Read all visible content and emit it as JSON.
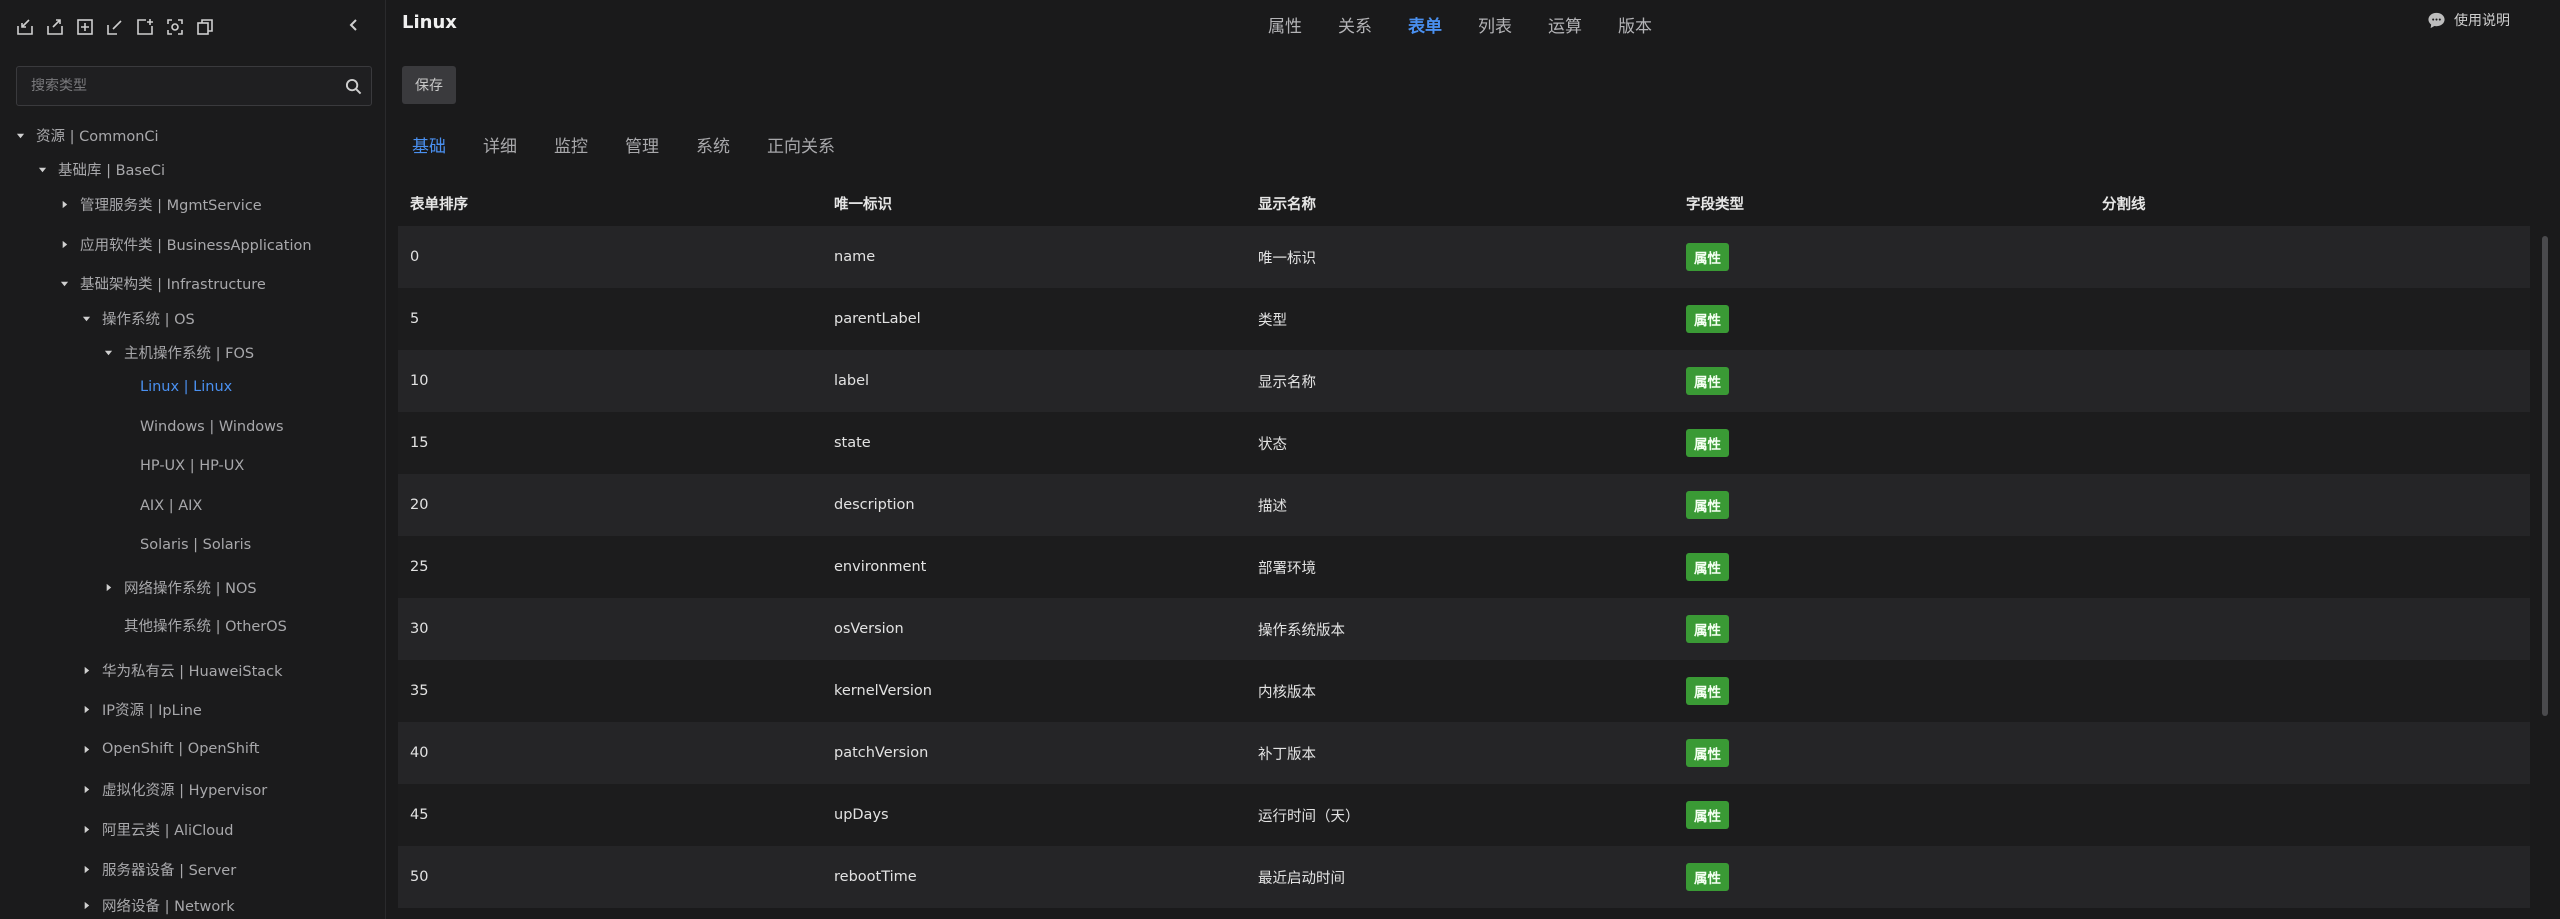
{
  "sidebar": {
    "search_placeholder": "搜索类型",
    "tree": [
      {
        "label": "资源 | CommonCi",
        "level": 0,
        "arrow": "down"
      },
      {
        "label": "基础库 | BaseCi",
        "level": 1,
        "arrow": "down"
      },
      {
        "label": "管理服务类 | MgmtService",
        "level": 2,
        "arrow": "right"
      },
      {
        "label": "应用软件类 | BusinessApplication",
        "level": 2,
        "arrow": "right"
      },
      {
        "label": "基础架构类 | Infrastructure",
        "level": 2,
        "arrow": "down"
      },
      {
        "label": "操作系统 | OS",
        "level": 3,
        "arrow": "down"
      },
      {
        "label": "主机操作系统 | FOS",
        "level": 4,
        "arrow": "down"
      },
      {
        "label": "Linux | Linux",
        "level": 5,
        "arrow": "none",
        "active": true
      },
      {
        "label": "Windows | Windows",
        "level": 5,
        "arrow": "none"
      },
      {
        "label": "HP-UX | HP-UX",
        "level": 5,
        "arrow": "none"
      },
      {
        "label": "AIX | AIX",
        "level": 5,
        "arrow": "none"
      },
      {
        "label": "Solaris | Solaris",
        "level": 5,
        "arrow": "none"
      },
      {
        "label": "网络操作系统 | NOS",
        "level": 4,
        "arrow": "right"
      },
      {
        "label": "其他操作系统 | OtherOS",
        "level": 4,
        "arrow": "none"
      },
      {
        "label": "华为私有云 | HuaweiStack",
        "level": 3,
        "arrow": "right"
      },
      {
        "label": "IP资源 | IpLine",
        "level": 3,
        "arrow": "right"
      },
      {
        "label": "OpenShift | OpenShift",
        "level": 3,
        "arrow": "right"
      },
      {
        "label": "虚拟化资源 | Hypervisor",
        "level": 3,
        "arrow": "right"
      },
      {
        "label": "阿里云类 | AliCloud",
        "level": 3,
        "arrow": "right"
      },
      {
        "label": "服务器设备 | Server",
        "level": 3,
        "arrow": "right"
      },
      {
        "label": "网络设备 | Network",
        "level": 3,
        "arrow": "right"
      }
    ]
  },
  "header": {
    "title": "Linux",
    "nav": [
      "属性",
      "关系",
      "表单",
      "列表",
      "运算",
      "版本"
    ],
    "active_nav": "表单",
    "help_label": "使用说明"
  },
  "toolbar": {
    "save_label": "保存"
  },
  "subtabs": [
    "基础",
    "详细",
    "监控",
    "管理",
    "系统",
    "正向关系"
  ],
  "active_subtab": "基础",
  "table": {
    "columns": [
      "表单排序",
      "唯一标识",
      "显示名称",
      "字段类型",
      "分割线"
    ],
    "rows": [
      {
        "order": "0",
        "id": "name",
        "display": "唯一标识",
        "type": "属性",
        "divider": ""
      },
      {
        "order": "5",
        "id": "parentLabel",
        "display": "类型",
        "type": "属性",
        "divider": ""
      },
      {
        "order": "10",
        "id": "label",
        "display": "显示名称",
        "type": "属性",
        "divider": ""
      },
      {
        "order": "15",
        "id": "state",
        "display": "状态",
        "type": "属性",
        "divider": ""
      },
      {
        "order": "20",
        "id": "description",
        "display": "描述",
        "type": "属性",
        "divider": ""
      },
      {
        "order": "25",
        "id": "environment",
        "display": "部署环境",
        "type": "属性",
        "divider": ""
      },
      {
        "order": "30",
        "id": "osVersion",
        "display": "操作系统版本",
        "type": "属性",
        "divider": ""
      },
      {
        "order": "35",
        "id": "kernelVersion",
        "display": "内核版本",
        "type": "属性",
        "divider": ""
      },
      {
        "order": "40",
        "id": "patchVersion",
        "display": "补丁版本",
        "type": "属性",
        "divider": ""
      },
      {
        "order": "45",
        "id": "upDays",
        "display": "运行时间（天）",
        "type": "属性",
        "divider": ""
      },
      {
        "order": "50",
        "id": "rebootTime",
        "display": "最近启动时间",
        "type": "属性",
        "divider": ""
      }
    ]
  },
  "colors": {
    "accent": "#4a90f0",
    "badge": "#3a9a35",
    "background": "#1a1a1b"
  },
  "icons": [
    "import-icon",
    "export-icon",
    "add-icon",
    "edit-icon",
    "add-square-icon",
    "scan-icon",
    "copy-icon",
    "collapse-left-icon",
    "search-icon",
    "help-chat-icon"
  ]
}
